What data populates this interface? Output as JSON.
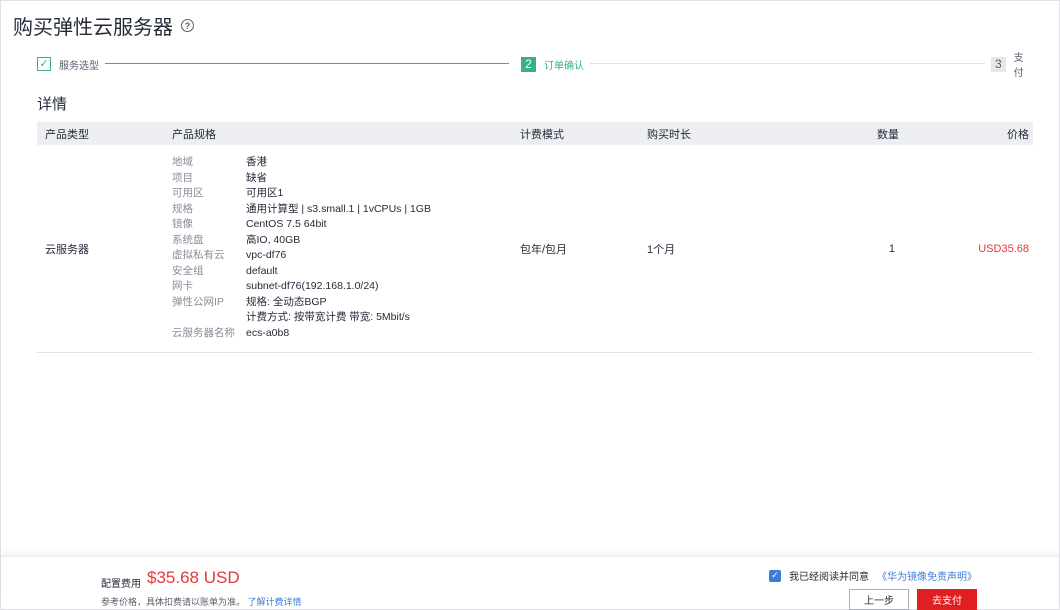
{
  "header": {
    "title": "购买弹性云服务器",
    "help_icon": "question-circle-icon"
  },
  "steps": [
    {
      "label": "服务选型",
      "state": "done"
    },
    {
      "number": "2",
      "label": "订单确认",
      "state": "active"
    },
    {
      "number": "3",
      "label": "支付",
      "state": "todo"
    }
  ],
  "section_title": "详情",
  "table": {
    "columns": [
      "产品类型",
      "产品规格",
      "计费模式",
      "购买时长",
      "数量",
      "价格"
    ],
    "row": {
      "type": "云服务器",
      "specs": [
        {
          "key": "地域",
          "value": "香港"
        },
        {
          "key": "项目",
          "value": "缺省"
        },
        {
          "key": "可用区",
          "value": "可用区1"
        },
        {
          "key": "规格",
          "value": "通用计算型 | s3.small.1 | 1vCPUs | 1GB"
        },
        {
          "key": "镜像",
          "value": "CentOS 7.5 64bit"
        },
        {
          "key": "系统盘",
          "value": "高IO, 40GB"
        },
        {
          "key": "虚拟私有云",
          "value": "vpc-df76"
        },
        {
          "key": "安全组",
          "value": "default"
        },
        {
          "key": "网卡",
          "value": "subnet-df76(192.168.1.0/24)"
        },
        {
          "key": "弹性公网IP",
          "value": "规格: 全动态BGP"
        },
        {
          "key": "",
          "value": "计费方式: 按带宽计费 带宽: 5Mbit/s"
        },
        {
          "key": "云服务器名称",
          "value": "ecs-a0b8"
        }
      ],
      "billing": "包年/包月",
      "duration": "1个月",
      "quantity": "1",
      "price": "USD35.68"
    }
  },
  "footer": {
    "fee_label": "配置费用",
    "fee_value": "$35.68 USD",
    "ref_note": "参考价格，具体扣费请以账单为准。",
    "ref_link": "了解计费详情",
    "agree_text": "我已经阅读并同意",
    "agree_link": "《华为镜像免责声明》",
    "agree_checked": true,
    "prev_label": "上一步",
    "pay_label": "去支付"
  },
  "colors": {
    "accent_green": "#36b37e",
    "price_red": "#e23b3b",
    "pay_button": "#e02020",
    "link_blue": "#3b7ed8"
  }
}
